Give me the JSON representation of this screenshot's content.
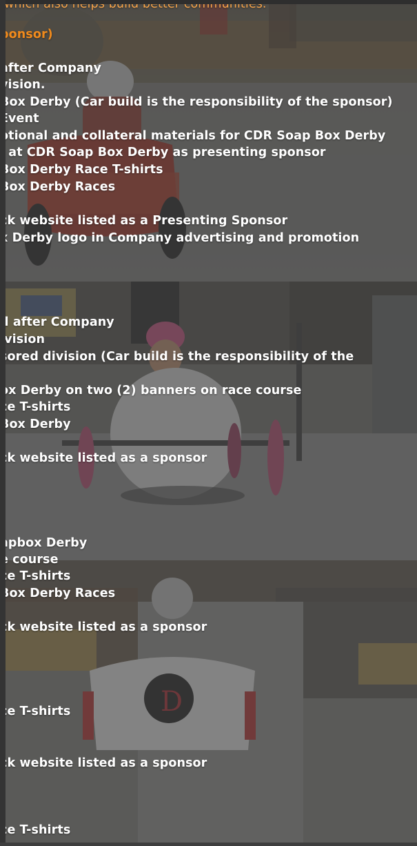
{
  "colors": {
    "text": "#ffffff",
    "accent": "#f08a1c",
    "overlay": "#3a3a3a"
  },
  "intro": {
    "partial_line": "which also helps build better communities."
  },
  "presenting": {
    "heading_fragment": "ponsor)",
    "benefits": [
      "after Company",
      "vision.",
      "Box Derby (Car build is the responsibility of the sponsor)",
      " Event",
      "otional and collateral materials for CDR Soap Box Derby",
      "l at CDR Soap Box Derby as presenting sponsor",
      "Box Derby Race T-shirts",
      "Box Derby Races",
      "ck website listed as a Presenting Sponsor",
      "x Derby logo in Company advertising and promotion"
    ]
  },
  "division": {
    "benefits": [
      "d after Company",
      "ivision",
      "sored division (Car build is the responsibility of the",
      "ox Derby on two (2) banners on race course",
      "ce T-shirts",
      "Box Derby",
      "ck website listed as a sponsor"
    ]
  },
  "course": {
    "benefits": [
      "apbox Derby",
      "e course",
      "ce T-shirts",
      "Box Derby Races",
      "ck website listed as a sponsor"
    ]
  },
  "supporter": {
    "benefits": [
      "ce T-shirts",
      "ck website listed as a sponsor"
    ]
  },
  "friend": {
    "benefits": [
      "ce T-shirts"
    ]
  }
}
